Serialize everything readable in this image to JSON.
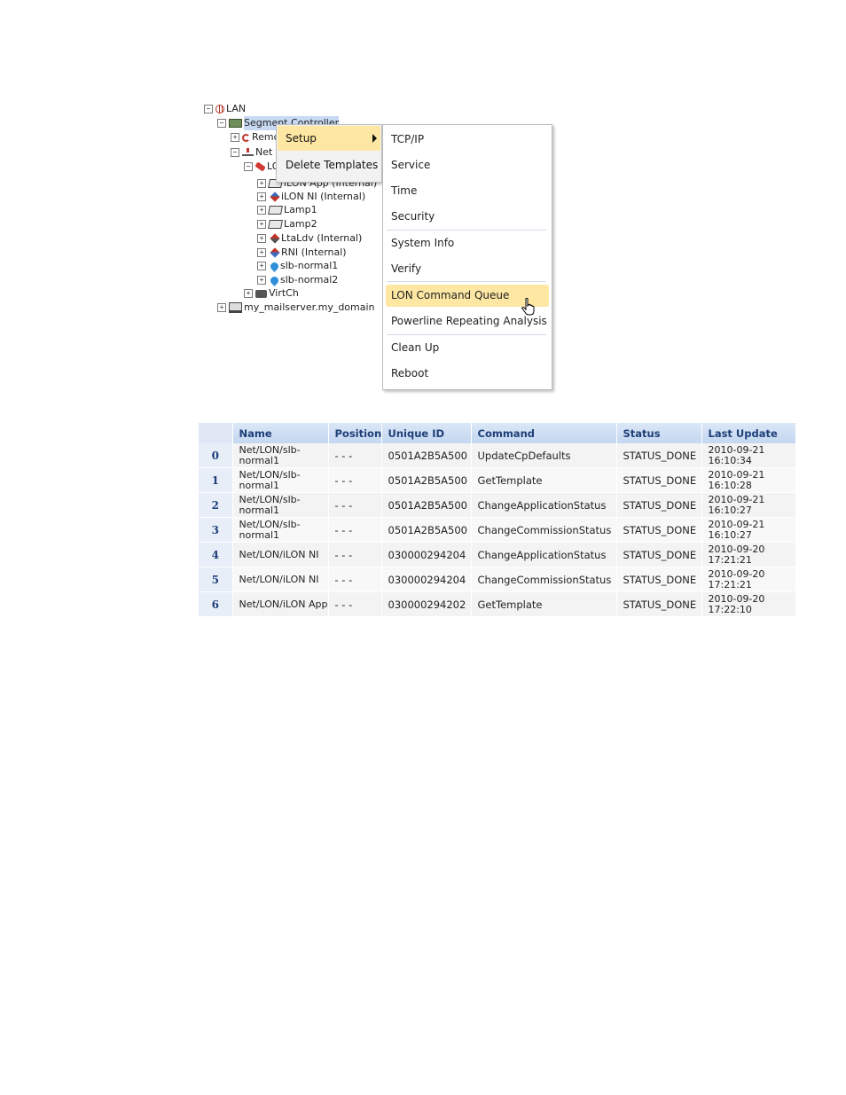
{
  "tree": {
    "items": [
      {
        "label": "LAN",
        "exp": "−",
        "icon": "globe-icon"
      },
      {
        "label": "Segment Controller",
        "exp": "−",
        "icon": "segment-controller-icon"
      },
      {
        "label": "Remote",
        "exp": "+",
        "icon": "remote-icon"
      },
      {
        "label": "Net",
        "exp": "−",
        "icon": "network-icon"
      },
      {
        "label": "LON",
        "exp": "−",
        "icon": "lon-channel-icon"
      },
      {
        "label": "iLON App (Internal)",
        "exp": "+",
        "icon": "device-icon"
      },
      {
        "label": "iLON NI (Internal)",
        "exp": "+",
        "icon": "ni-icon"
      },
      {
        "label": "Lamp1",
        "exp": "+",
        "icon": "device-icon"
      },
      {
        "label": "Lamp2",
        "exp": "+",
        "icon": "device-icon"
      },
      {
        "label": "LtaLdv (Internal)",
        "exp": "+",
        "icon": "ldv-icon"
      },
      {
        "label": "RNI (Internal)",
        "exp": "+",
        "icon": "rni-icon"
      },
      {
        "label": "slb-normal1",
        "exp": "+",
        "icon": "drop-icon"
      },
      {
        "label": "slb-normal2",
        "exp": "+",
        "icon": "drop-icon"
      },
      {
        "label": "VirtCh",
        "exp": "+",
        "icon": "virtual-channel-icon"
      },
      {
        "label": "my_mailserver.my_domain",
        "exp": "+",
        "icon": "server-icon"
      }
    ]
  },
  "context_menu": {
    "items": [
      "Setup",
      "Delete Templates"
    ]
  },
  "setup_submenu": {
    "items": [
      "TCP/IP",
      "Service",
      "Time",
      "Security",
      "System Info",
      "Verify",
      "LON Command Queue",
      "Powerline Repeating Analysis",
      "Clean Up",
      "Reboot"
    ],
    "highlighted": "LON Command Queue"
  },
  "queue_table": {
    "columns": [
      "",
      "Name",
      "Position",
      "Unique ID",
      "Command",
      "Status",
      "Last Update"
    ],
    "rows": [
      {
        "idx": "0",
        "name": "Net/LON/slb-normal1",
        "position": "- - -",
        "uid": "0501A2B5A500",
        "command": "UpdateCpDefaults",
        "status": "STATUS_DONE",
        "updated": "2010-09-21 16:10:34"
      },
      {
        "idx": "1",
        "name": "Net/LON/slb-normal1",
        "position": "- - -",
        "uid": "0501A2B5A500",
        "command": "GetTemplate",
        "status": "STATUS_DONE",
        "updated": "2010-09-21 16:10:28"
      },
      {
        "idx": "2",
        "name": "Net/LON/slb-normal1",
        "position": "- - -",
        "uid": "0501A2B5A500",
        "command": "ChangeApplicationStatus",
        "status": "STATUS_DONE",
        "updated": "2010-09-21 16:10:27"
      },
      {
        "idx": "3",
        "name": "Net/LON/slb-normal1",
        "position": "- - -",
        "uid": "0501A2B5A500",
        "command": "ChangeCommissionStatus",
        "status": "STATUS_DONE",
        "updated": "2010-09-21 16:10:27"
      },
      {
        "idx": "4",
        "name": "Net/LON/iLON NI",
        "position": "- - -",
        "uid": "030000294204",
        "command": "ChangeApplicationStatus",
        "status": "STATUS_DONE",
        "updated": "2010-09-20 17:21:21"
      },
      {
        "idx": "5",
        "name": "Net/LON/iLON NI",
        "position": "- - -",
        "uid": "030000294204",
        "command": "ChangeCommissionStatus",
        "status": "STATUS_DONE",
        "updated": "2010-09-20 17:21:21"
      },
      {
        "idx": "6",
        "name": "Net/LON/iLON App",
        "position": "- - -",
        "uid": "030000294202",
        "command": "GetTemplate",
        "status": "STATUS_DONE",
        "updated": "2010-09-20 17:22:10"
      }
    ]
  }
}
